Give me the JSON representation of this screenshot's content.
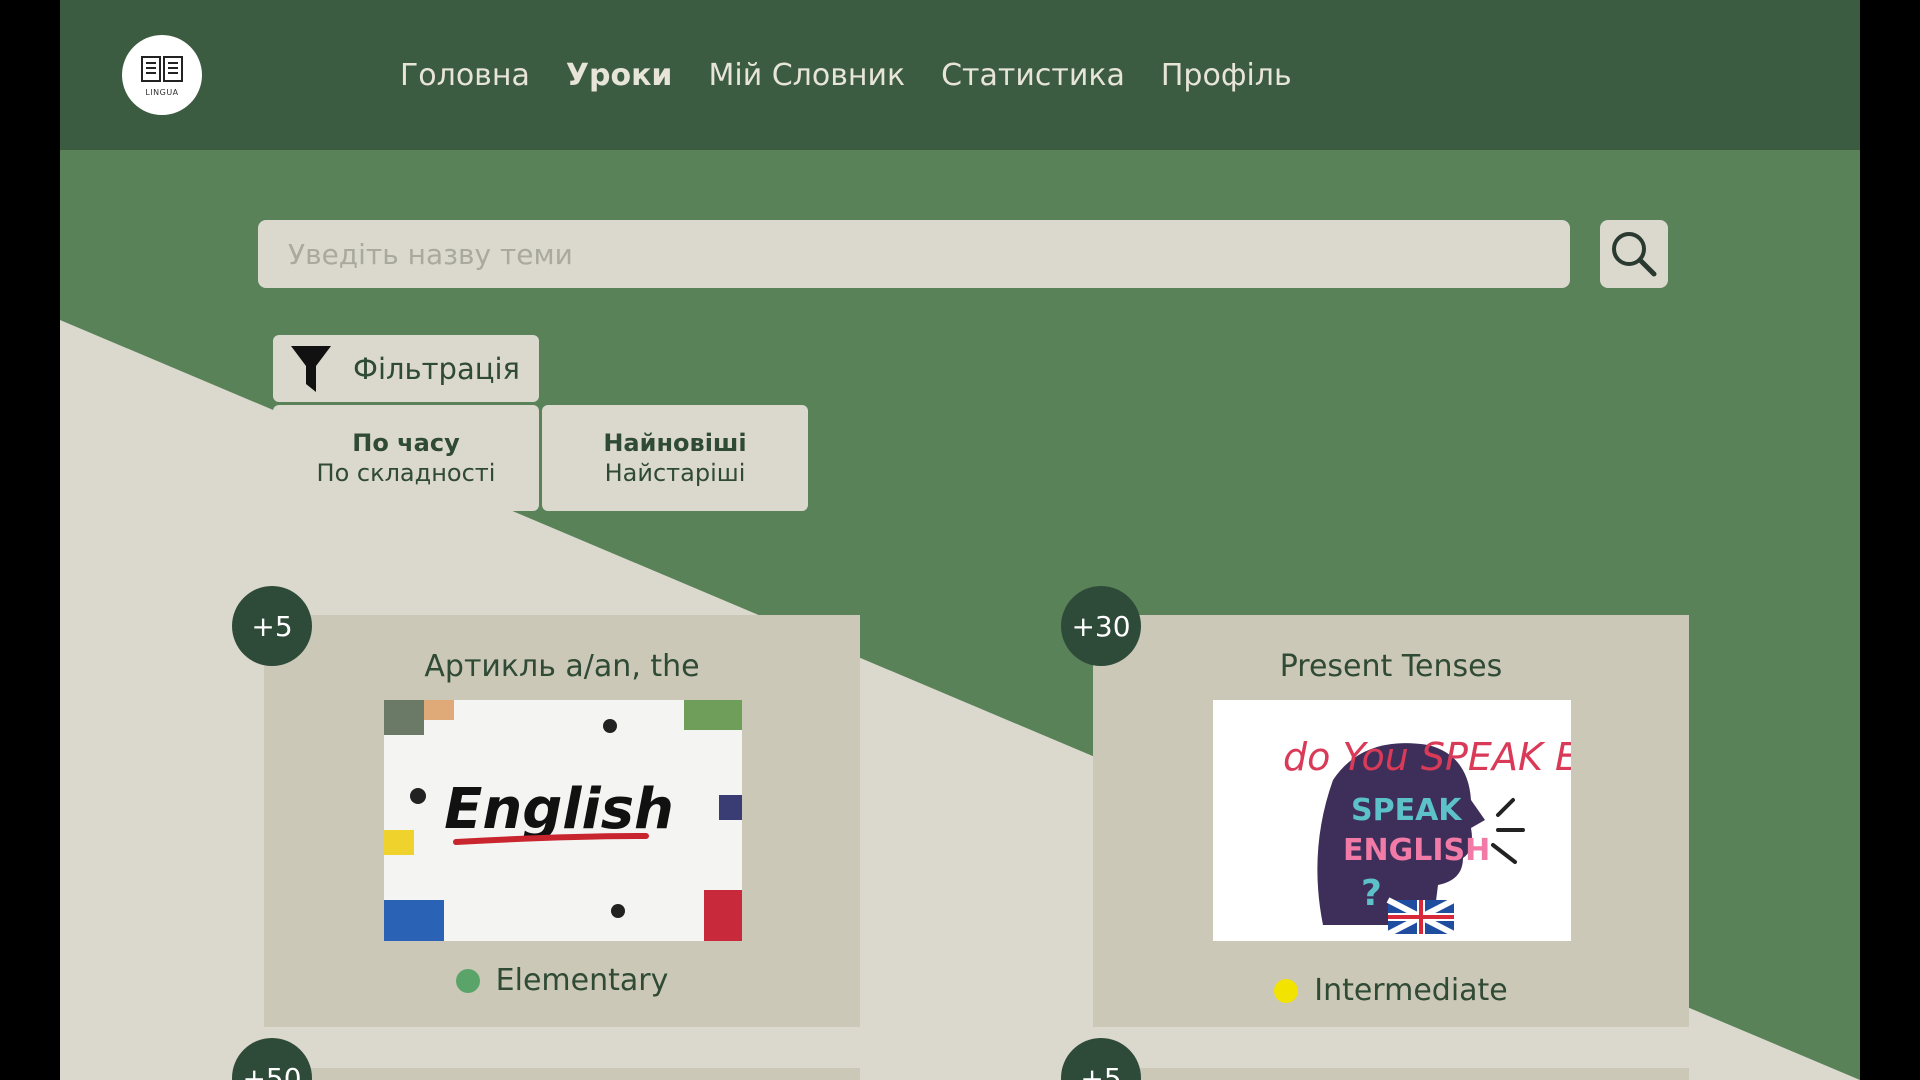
{
  "app": {
    "logo_text": "LINGUA"
  },
  "nav": {
    "items": [
      {
        "label": "Головна",
        "active": false
      },
      {
        "label": "Уроки",
        "active": true
      },
      {
        "label": "Мій Словник",
        "active": false
      },
      {
        "label": "Статистика",
        "active": false
      },
      {
        "label": "Профіль",
        "active": false
      }
    ]
  },
  "search": {
    "placeholder": "Уведіть назву теми",
    "value": ""
  },
  "filter": {
    "label": "Фільтрація",
    "group1": {
      "selected": "По часу",
      "other": "По складності"
    },
    "group2": {
      "selected": "Найновіші",
      "other": "Найстаріші"
    }
  },
  "lessons": [
    {
      "badge": "+5",
      "title": "Артикль a/an, the",
      "image_text": "English",
      "level": "Elementary",
      "level_color": "#5aa46a"
    },
    {
      "badge": "+30",
      "title": "Present Tenses",
      "image_text": "do You SPEAK ENGLISH ?",
      "level": "Intermediate",
      "level_color": "#f2e300"
    },
    {
      "badge": "+50",
      "title": "",
      "level": ""
    },
    {
      "badge": "+5",
      "title": "",
      "level": ""
    }
  ],
  "colors": {
    "header": "#3c5c41",
    "background_green": "#5a8259",
    "beige": "#dbd9cd",
    "card": "#ccc8b7",
    "badge": "#2e4a39"
  }
}
